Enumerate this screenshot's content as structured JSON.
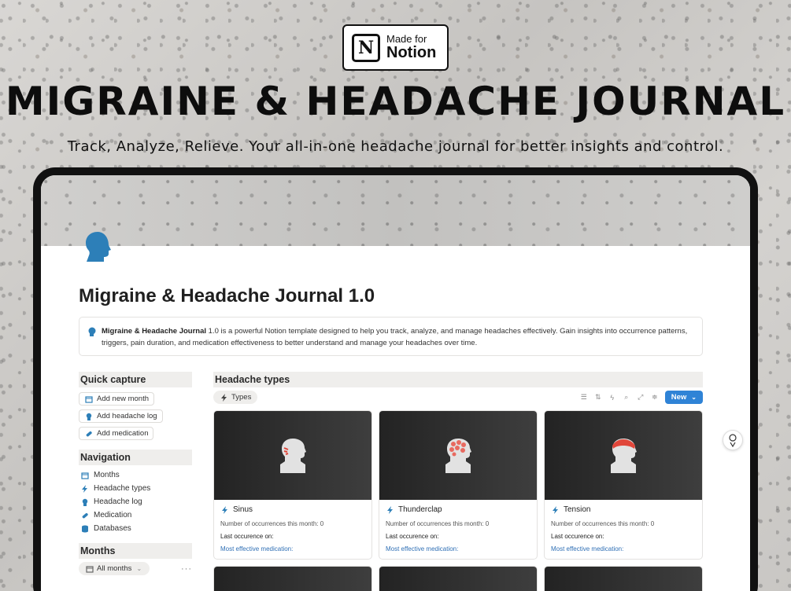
{
  "badge": {
    "made_for": "Made for",
    "brand": "Notion"
  },
  "hero": {
    "title": "MIGRAINE & HEADACHE JOURNAL",
    "tagline": "Track, Analyze, Relieve. Your all-in-one headache journal for better insights and control."
  },
  "page": {
    "title": "Migraine & Headache Journal 1.0",
    "callout_bold": "Migraine & Headache Journal",
    "callout_rest": " 1.0 is a powerful Notion template designed to help you track, analyze, and manage headaches effectively. Gain insights into occurrence patterns, triggers, pain duration, and medication effectiveness to better understand and manage your headaches over time."
  },
  "sidebar": {
    "quick_capture": {
      "heading": "Quick capture",
      "buttons": [
        "Add new month",
        "Add headache log",
        "Add medication"
      ]
    },
    "navigation": {
      "heading": "Navigation",
      "items": [
        "Months",
        "Headache types",
        "Headache log",
        "Medication",
        "Databases"
      ]
    },
    "months": {
      "heading": "Months",
      "chip": "All months",
      "more": "···"
    }
  },
  "main": {
    "heading": "Headache types",
    "tab": "Types",
    "new_button": "New",
    "cards": [
      {
        "title": "Sinus",
        "occ": "Number of occurrences this month: 0",
        "last": "Last occurence on:",
        "med": "Most effective medication:",
        "accent": "#e0463a",
        "style": "lines"
      },
      {
        "title": "Thunderclap",
        "occ": "Number of occurrences this month: 0",
        "last": "Last occurence on:",
        "med": "Most effective medication:",
        "accent": "#e0463a",
        "style": "dots"
      },
      {
        "title": "Tension",
        "occ": "Number of occurrences this month: 0",
        "last": "Last occurence on:",
        "med": "Most effective medication:",
        "accent": "#e0463a",
        "style": "band"
      }
    ]
  },
  "colors": {
    "accent": "#2f83d6",
    "icon_blue": "#2d7fb8"
  }
}
